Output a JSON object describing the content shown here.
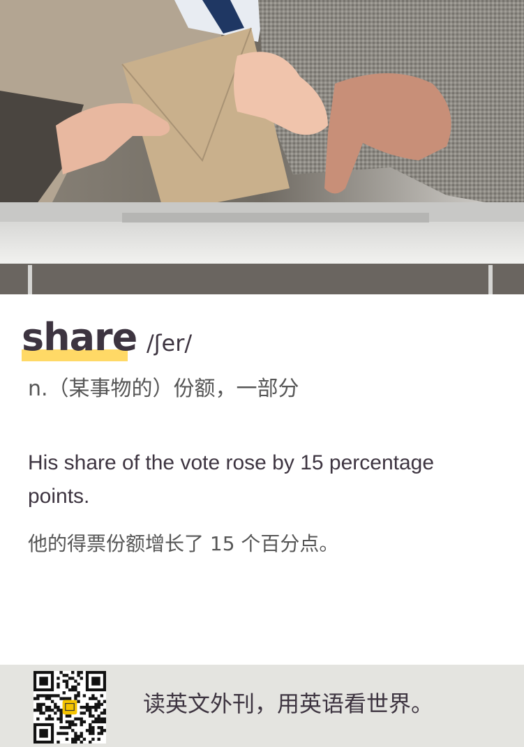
{
  "entry": {
    "word": "share",
    "phonetic": "/ʃer/",
    "definition": "n.（某事物的）份额，一部分",
    "example_en": "His share of the vote rose by 15 percentage points.",
    "example_zh": "他的得票份额增长了 15 个百分点。"
  },
  "footer": {
    "slogan": "读英文外刊，用英语看世界。"
  },
  "colors": {
    "highlight": "#ffd966",
    "text_dark": "#3d3440",
    "footer_bg": "#e4e4e0"
  }
}
